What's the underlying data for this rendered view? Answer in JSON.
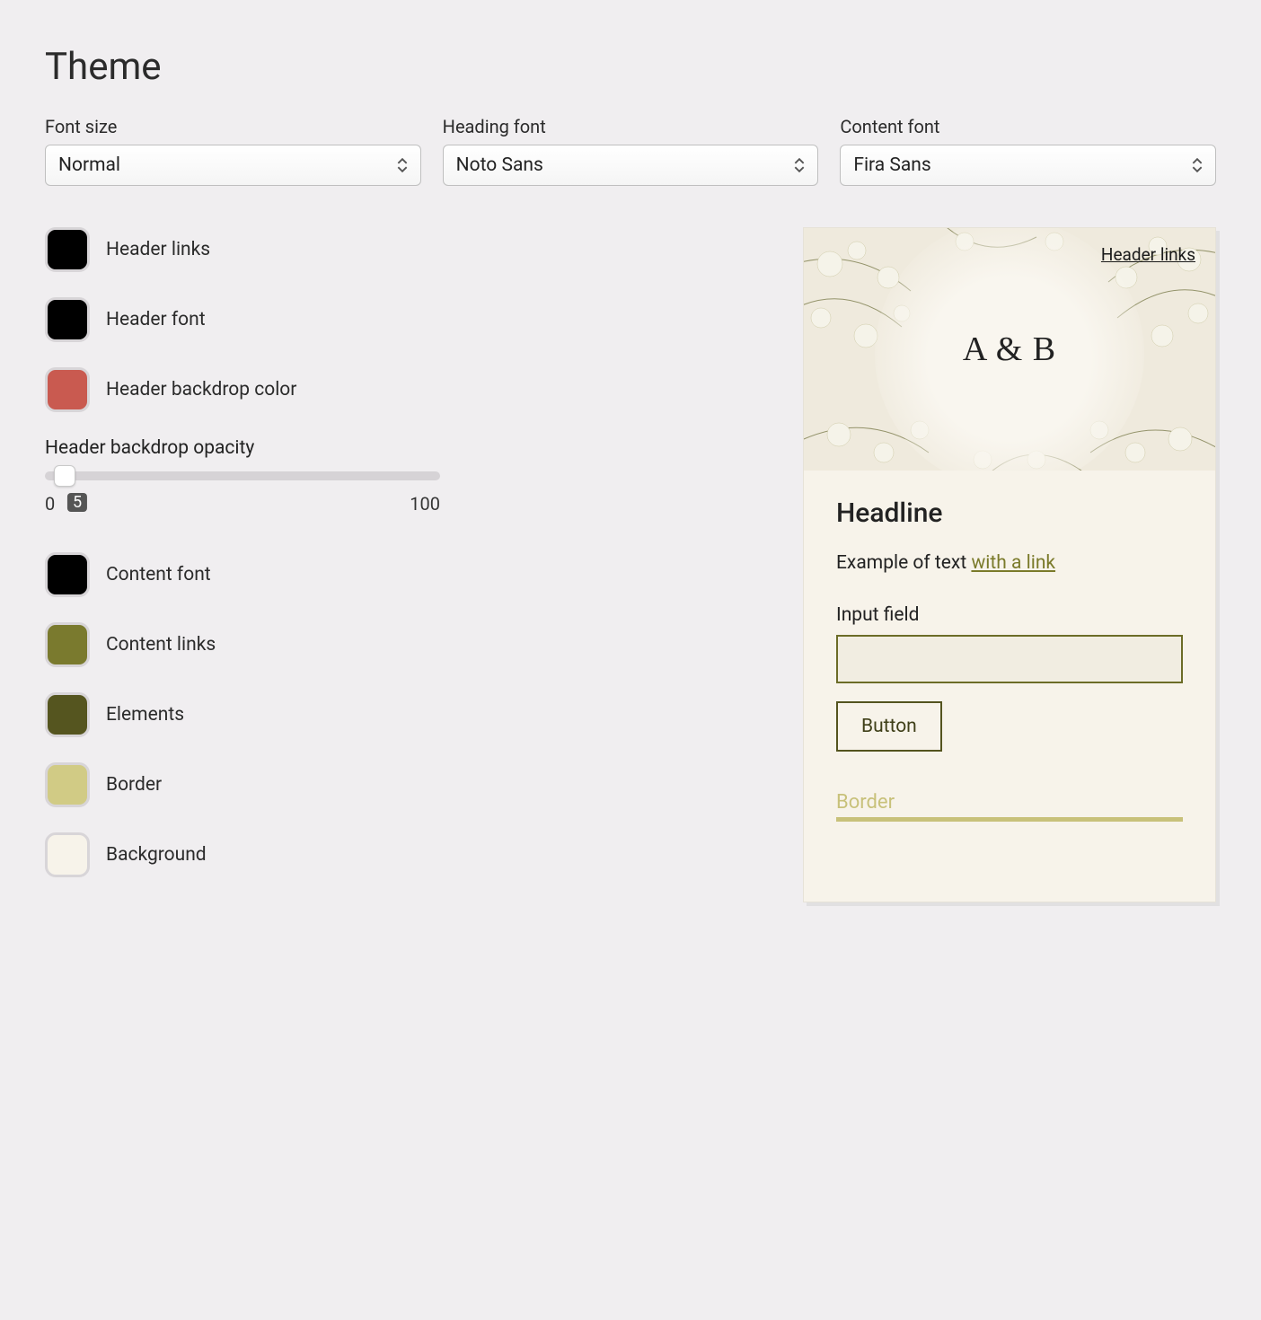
{
  "title": "Theme",
  "selects": {
    "font_size": {
      "label": "Font size",
      "value": "Normal"
    },
    "heading_font": {
      "label": "Heading font",
      "value": "Noto Sans"
    },
    "content_font": {
      "label": "Content font",
      "value": "Fira Sans"
    }
  },
  "swatches_top": [
    {
      "label": "Header links",
      "color": "#000000"
    },
    {
      "label": "Header font",
      "color": "#000000"
    },
    {
      "label": "Header backdrop color",
      "color": "#c95a50"
    }
  ],
  "slider": {
    "label": "Header backdrop opacity",
    "min": "0",
    "max": "100",
    "value": "5",
    "percent": 5
  },
  "swatches_bottom": [
    {
      "label": "Content font",
      "color": "#000000"
    },
    {
      "label": "Content links",
      "color": "#7a7a2e"
    },
    {
      "label": "Elements",
      "color": "#55551f"
    },
    {
      "label": "Border",
      "color": "#d1cb85"
    },
    {
      "label": "Background",
      "color": "#f7f3ea"
    }
  ],
  "preview": {
    "header_link": "Header links",
    "header_title": "A & B",
    "headline": "Headline",
    "text_prefix": "Example of text ",
    "text_link": "with a link",
    "input_label": "Input field",
    "button_label": "Button",
    "border_label": "Border"
  }
}
